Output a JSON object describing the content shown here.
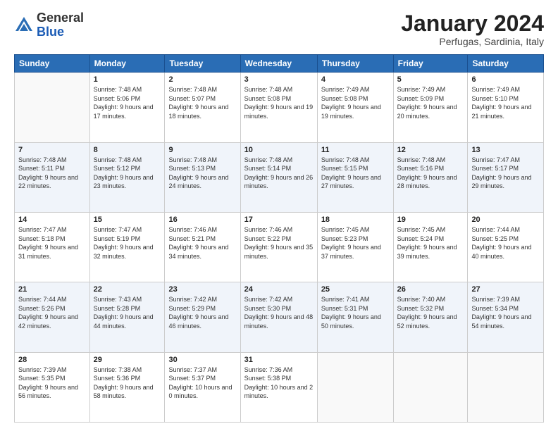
{
  "header": {
    "logo_general": "General",
    "logo_blue": "Blue",
    "title": "January 2024",
    "location": "Perfugas, Sardinia, Italy"
  },
  "columns": [
    "Sunday",
    "Monday",
    "Tuesday",
    "Wednesday",
    "Thursday",
    "Friday",
    "Saturday"
  ],
  "weeks": [
    [
      {
        "day": "",
        "sunrise": "",
        "sunset": "",
        "daylight": "",
        "empty": true
      },
      {
        "day": "1",
        "sunrise": "Sunrise: 7:48 AM",
        "sunset": "Sunset: 5:06 PM",
        "daylight": "Daylight: 9 hours and 17 minutes."
      },
      {
        "day": "2",
        "sunrise": "Sunrise: 7:48 AM",
        "sunset": "Sunset: 5:07 PM",
        "daylight": "Daylight: 9 hours and 18 minutes."
      },
      {
        "day": "3",
        "sunrise": "Sunrise: 7:48 AM",
        "sunset": "Sunset: 5:08 PM",
        "daylight": "Daylight: 9 hours and 19 minutes."
      },
      {
        "day": "4",
        "sunrise": "Sunrise: 7:49 AM",
        "sunset": "Sunset: 5:08 PM",
        "daylight": "Daylight: 9 hours and 19 minutes."
      },
      {
        "day": "5",
        "sunrise": "Sunrise: 7:49 AM",
        "sunset": "Sunset: 5:09 PM",
        "daylight": "Daylight: 9 hours and 20 minutes."
      },
      {
        "day": "6",
        "sunrise": "Sunrise: 7:49 AM",
        "sunset": "Sunset: 5:10 PM",
        "daylight": "Daylight: 9 hours and 21 minutes."
      }
    ],
    [
      {
        "day": "7",
        "sunrise": "Sunrise: 7:48 AM",
        "sunset": "Sunset: 5:11 PM",
        "daylight": "Daylight: 9 hours and 22 minutes."
      },
      {
        "day": "8",
        "sunrise": "Sunrise: 7:48 AM",
        "sunset": "Sunset: 5:12 PM",
        "daylight": "Daylight: 9 hours and 23 minutes."
      },
      {
        "day": "9",
        "sunrise": "Sunrise: 7:48 AM",
        "sunset": "Sunset: 5:13 PM",
        "daylight": "Daylight: 9 hours and 24 minutes."
      },
      {
        "day": "10",
        "sunrise": "Sunrise: 7:48 AM",
        "sunset": "Sunset: 5:14 PM",
        "daylight": "Daylight: 9 hours and 26 minutes."
      },
      {
        "day": "11",
        "sunrise": "Sunrise: 7:48 AM",
        "sunset": "Sunset: 5:15 PM",
        "daylight": "Daylight: 9 hours and 27 minutes."
      },
      {
        "day": "12",
        "sunrise": "Sunrise: 7:48 AM",
        "sunset": "Sunset: 5:16 PM",
        "daylight": "Daylight: 9 hours and 28 minutes."
      },
      {
        "day": "13",
        "sunrise": "Sunrise: 7:47 AM",
        "sunset": "Sunset: 5:17 PM",
        "daylight": "Daylight: 9 hours and 29 minutes."
      }
    ],
    [
      {
        "day": "14",
        "sunrise": "Sunrise: 7:47 AM",
        "sunset": "Sunset: 5:18 PM",
        "daylight": "Daylight: 9 hours and 31 minutes."
      },
      {
        "day": "15",
        "sunrise": "Sunrise: 7:47 AM",
        "sunset": "Sunset: 5:19 PM",
        "daylight": "Daylight: 9 hours and 32 minutes."
      },
      {
        "day": "16",
        "sunrise": "Sunrise: 7:46 AM",
        "sunset": "Sunset: 5:21 PM",
        "daylight": "Daylight: 9 hours and 34 minutes."
      },
      {
        "day": "17",
        "sunrise": "Sunrise: 7:46 AM",
        "sunset": "Sunset: 5:22 PM",
        "daylight": "Daylight: 9 hours and 35 minutes."
      },
      {
        "day": "18",
        "sunrise": "Sunrise: 7:45 AM",
        "sunset": "Sunset: 5:23 PM",
        "daylight": "Daylight: 9 hours and 37 minutes."
      },
      {
        "day": "19",
        "sunrise": "Sunrise: 7:45 AM",
        "sunset": "Sunset: 5:24 PM",
        "daylight": "Daylight: 9 hours and 39 minutes."
      },
      {
        "day": "20",
        "sunrise": "Sunrise: 7:44 AM",
        "sunset": "Sunset: 5:25 PM",
        "daylight": "Daylight: 9 hours and 40 minutes."
      }
    ],
    [
      {
        "day": "21",
        "sunrise": "Sunrise: 7:44 AM",
        "sunset": "Sunset: 5:26 PM",
        "daylight": "Daylight: 9 hours and 42 minutes."
      },
      {
        "day": "22",
        "sunrise": "Sunrise: 7:43 AM",
        "sunset": "Sunset: 5:28 PM",
        "daylight": "Daylight: 9 hours and 44 minutes."
      },
      {
        "day": "23",
        "sunrise": "Sunrise: 7:42 AM",
        "sunset": "Sunset: 5:29 PM",
        "daylight": "Daylight: 9 hours and 46 minutes."
      },
      {
        "day": "24",
        "sunrise": "Sunrise: 7:42 AM",
        "sunset": "Sunset: 5:30 PM",
        "daylight": "Daylight: 9 hours and 48 minutes."
      },
      {
        "day": "25",
        "sunrise": "Sunrise: 7:41 AM",
        "sunset": "Sunset: 5:31 PM",
        "daylight": "Daylight: 9 hours and 50 minutes."
      },
      {
        "day": "26",
        "sunrise": "Sunrise: 7:40 AM",
        "sunset": "Sunset: 5:32 PM",
        "daylight": "Daylight: 9 hours and 52 minutes."
      },
      {
        "day": "27",
        "sunrise": "Sunrise: 7:39 AM",
        "sunset": "Sunset: 5:34 PM",
        "daylight": "Daylight: 9 hours and 54 minutes."
      }
    ],
    [
      {
        "day": "28",
        "sunrise": "Sunrise: 7:39 AM",
        "sunset": "Sunset: 5:35 PM",
        "daylight": "Daylight: 9 hours and 56 minutes."
      },
      {
        "day": "29",
        "sunrise": "Sunrise: 7:38 AM",
        "sunset": "Sunset: 5:36 PM",
        "daylight": "Daylight: 9 hours and 58 minutes."
      },
      {
        "day": "30",
        "sunrise": "Sunrise: 7:37 AM",
        "sunset": "Sunset: 5:37 PM",
        "daylight": "Daylight: 10 hours and 0 minutes."
      },
      {
        "day": "31",
        "sunrise": "Sunrise: 7:36 AM",
        "sunset": "Sunset: 5:38 PM",
        "daylight": "Daylight: 10 hours and 2 minutes."
      },
      {
        "day": "",
        "sunrise": "",
        "sunset": "",
        "daylight": "",
        "empty": true
      },
      {
        "day": "",
        "sunrise": "",
        "sunset": "",
        "daylight": "",
        "empty": true
      },
      {
        "day": "",
        "sunrise": "",
        "sunset": "",
        "daylight": "",
        "empty": true
      }
    ]
  ]
}
